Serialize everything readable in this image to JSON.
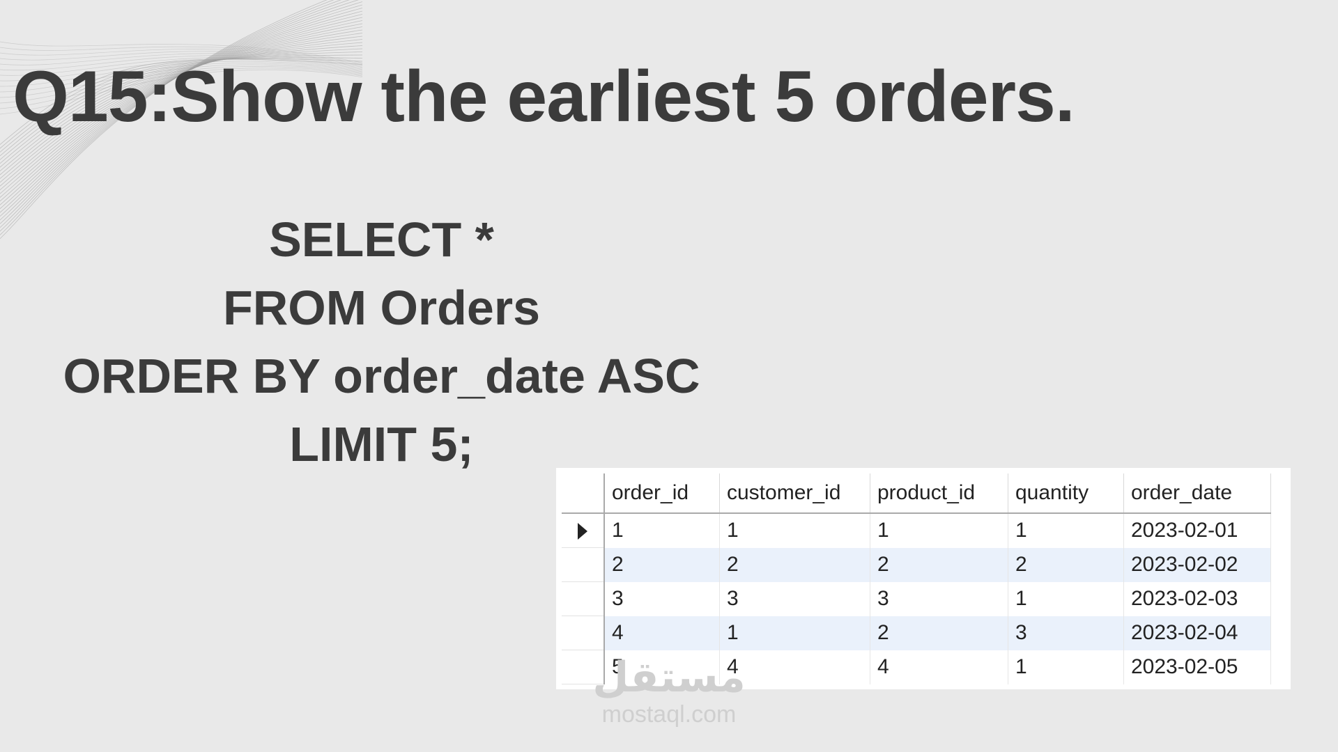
{
  "slide": {
    "title": "Q15:Show the earliest 5 orders.",
    "sql_lines": [
      "SELECT *",
      "FROM Orders",
      "ORDER BY order_date ASC",
      "LIMIT 5;"
    ]
  },
  "result_grid": {
    "columns": [
      "order_id",
      "customer_id",
      "product_id",
      "quantity",
      "order_date"
    ],
    "rows": [
      [
        "1",
        "1",
        "1",
        "1",
        "2023-02-01"
      ],
      [
        "2",
        "2",
        "2",
        "2",
        "2023-02-02"
      ],
      [
        "3",
        "3",
        "3",
        "1",
        "2023-02-03"
      ],
      [
        "4",
        "1",
        "2",
        "3",
        "2023-02-04"
      ],
      [
        "5",
        "4",
        "4",
        "1",
        "2023-02-05"
      ]
    ],
    "selected_row_indicator": "caret-right-icon"
  },
  "watermark": {
    "arabic": "مستقل",
    "text": "mostaql.com"
  },
  "colors": {
    "background": "#e9e9e9",
    "text": "#3b3b3b",
    "alt_row": "#eaf1fb"
  }
}
